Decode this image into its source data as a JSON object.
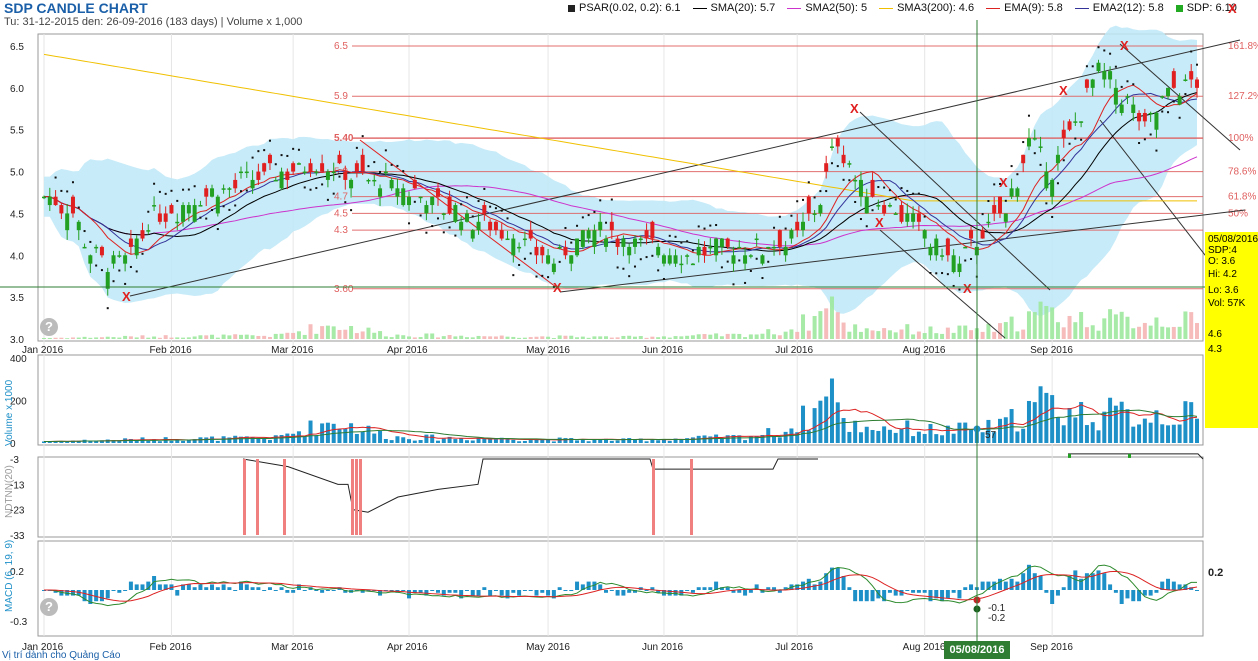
{
  "header": {
    "title": "SDP CANDLE CHART",
    "subtitle": "Tu: 31-12-2015 den: 26-09-2016 (183 days) | Volume x 1,000"
  },
  "legend": [
    {
      "label": "PSAR(0.02, 0.2): 6.1",
      "color": "#222222",
      "kind": "box"
    },
    {
      "label": "SMA(20): 5.7",
      "color": "#000000",
      "kind": "line"
    },
    {
      "label": "SMA2(50): 5",
      "color": "#cc33cc",
      "kind": "line"
    },
    {
      "label": "SMA3(200): 4.6",
      "color": "#f0c000",
      "kind": "line"
    },
    {
      "label": "EMA(9): 5.8",
      "color": "#dd2222",
      "kind": "line"
    },
    {
      "label": "EMA2(12): 5.8",
      "color": "#333399",
      "kind": "line"
    },
    {
      "label": "SDP: 6.10",
      "color": "#22aa22",
      "kind": "box"
    }
  ],
  "colors": {
    "up": "#22a022",
    "down": "#e02020",
    "bollinger": "#bde8f7",
    "volume": "#1e90c8",
    "fib": "#e06060",
    "crosshair": "#2e7d32"
  },
  "panels": {
    "price_ylabels": [
      "6.5",
      "6.0",
      "5.5",
      "5.0",
      "4.5",
      "4.0",
      "3.5",
      "3.0"
    ],
    "volume_ylabels": [
      "400",
      "200",
      "0"
    ],
    "volume_title": "Volume x 1000",
    "ndtnn_ylabels": [
      "-3",
      "-13",
      "-23",
      "-33"
    ],
    "ndtnn_title": "NDTNN(20)",
    "macd_ylabels": [
      "0.2",
      "-0.3"
    ],
    "macd_title": "MACD (6, 19, 9)",
    "x_ticks": [
      "Jan 2016",
      "Feb 2016",
      "Mar 2016",
      "Apr 2016",
      "May 2016",
      "Jun 2016",
      "Jul 2016",
      "Aug 2016",
      "Sep 2016"
    ]
  },
  "fib_levels": [
    {
      "price": "6.5",
      "pct": "161.8%"
    },
    {
      "price": "5.9",
      "pct": "127.2%"
    },
    {
      "price": "5.40",
      "pct": "100%"
    },
    {
      "price": "5.0",
      "pct": "78.6%"
    },
    {
      "price": "4.7",
      "pct": "61.8%"
    },
    {
      "price": "4.5",
      "pct": "50%"
    },
    {
      "price": "4.3",
      "pct": ""
    },
    {
      "price": "3.60",
      "pct": ""
    }
  ],
  "right_values": {
    "volume_last": "125",
    "macd_last": "0.2",
    "vol_marker": "57",
    "macd_marker_1": "-0.1",
    "macd_marker_2": "-0.2",
    "price_marker_1": "4.6",
    "price_marker_2": "4.3"
  },
  "info_box": {
    "date": "05/08/2016",
    "symbol": "SDP:4",
    "open": "O: 3.6",
    "high": "Hi: 4.2",
    "low": "Lo: 3.6",
    "volume": "Vol: 57K"
  },
  "crosshair": {
    "date": "05/08/2016"
  },
  "footer": {
    "link": "Vị trí dành cho Quảng Cáo"
  },
  "chart_data": {
    "type": "candlestick",
    "symbol": "SDP",
    "title": "SDP CANDLE CHART",
    "date_range": [
      "31-12-2015",
      "26-09-2016"
    ],
    "trading_days": 183,
    "price_axis": {
      "min": 3.0,
      "max": 6.6,
      "ticks": [
        3.0,
        3.5,
        4.0,
        4.5,
        5.0,
        5.5,
        6.0,
        6.5
      ]
    },
    "volume_axis": {
      "min": 0,
      "max": 400,
      "ticks": [
        0,
        200,
        400
      ],
      "unit": "x 1000"
    },
    "ndtnn_axis": {
      "min": -35,
      "max": 0,
      "ticks": [
        -3,
        -13,
        -23,
        -33
      ]
    },
    "macd_axis": {
      "ticks": [
        0.2,
        -0.3
      ]
    },
    "month_labels": [
      "Jan 2016",
      "Feb 2016",
      "Mar 2016",
      "Apr 2016",
      "May 2016",
      "Jun 2016",
      "Jul 2016",
      "Aug 2016",
      "Sep 2016"
    ],
    "month_start_index": [
      0,
      22,
      43,
      63,
      87,
      107,
      130,
      152,
      174
    ],
    "price_anchors": [
      [
        0,
        4.7
      ],
      [
        5,
        4.5
      ],
      [
        8,
        4.0
      ],
      [
        14,
        3.9
      ],
      [
        18,
        4.4
      ],
      [
        24,
        4.6
      ],
      [
        30,
        4.8
      ],
      [
        36,
        4.9
      ],
      [
        42,
        5.0
      ],
      [
        48,
        5.1
      ],
      [
        52,
        5.0
      ],
      [
        56,
        4.9
      ],
      [
        62,
        4.8
      ],
      [
        68,
        4.6
      ],
      [
        74,
        4.4
      ],
      [
        80,
        4.3
      ],
      [
        84,
        4.1
      ],
      [
        88,
        3.9
      ],
      [
        92,
        4.2
      ],
      [
        96,
        4.3
      ],
      [
        100,
        4.2
      ],
      [
        106,
        4.1
      ],
      [
        112,
        4.0
      ],
      [
        118,
        4.1
      ],
      [
        124,
        4.1
      ],
      [
        130,
        4.2
      ],
      [
        134,
        4.7
      ],
      [
        137,
        5.4
      ],
      [
        141,
        4.8
      ],
      [
        146,
        4.6
      ],
      [
        150,
        4.4
      ],
      [
        154,
        4.1
      ],
      [
        158,
        3.9
      ],
      [
        162,
        4.3
      ],
      [
        166,
        4.5
      ],
      [
        170,
        5.4
      ],
      [
        174,
        5.0
      ],
      [
        178,
        5.6
      ],
      [
        182,
        6.2
      ],
      [
        186,
        5.9
      ],
      [
        190,
        5.5
      ],
      [
        195,
        6.0
      ],
      [
        199,
        6.1
      ]
    ],
    "volume_anchors": [
      [
        0,
        8
      ],
      [
        20,
        20
      ],
      [
        40,
        25
      ],
      [
        50,
        110
      ],
      [
        60,
        30
      ],
      [
        80,
        20
      ],
      [
        100,
        15
      ],
      [
        120,
        30
      ],
      [
        128,
        60
      ],
      [
        134,
        180
      ],
      [
        135,
        400
      ],
      [
        138,
        90
      ],
      [
        150,
        70
      ],
      [
        155,
        60
      ],
      [
        165,
        80
      ],
      [
        172,
        200
      ],
      [
        178,
        150
      ],
      [
        188,
        140
      ],
      [
        195,
        150
      ],
      [
        199,
        125
      ]
    ],
    "series": [
      {
        "name": "PSAR(0.02, 0.2)",
        "last": 6.1
      },
      {
        "name": "SMA(20)",
        "last": 5.7
      },
      {
        "name": "SMA2(50)",
        "last": 5.0
      },
      {
        "name": "SMA3(200)",
        "last": 4.6
      },
      {
        "name": "EMA(9)",
        "last": 5.8
      },
      {
        "name": "EMA2(12)",
        "last": 5.8
      },
      {
        "name": "SDP",
        "last": 6.1
      }
    ],
    "fibonacci": [
      {
        "level": "161.8%",
        "price": 6.5
      },
      {
        "level": "127.2%",
        "price": 5.9
      },
      {
        "level": "100%",
        "price": 5.4
      },
      {
        "level": "78.6%",
        "price": 5.0
      },
      {
        "level": "61.8%",
        "price": 4.7
      },
      {
        "level": "50%",
        "price": 4.5
      },
      {
        "price": 4.3
      },
      {
        "price": 3.6
      }
    ],
    "volume_last": 125,
    "macd_last": 0.2
  }
}
